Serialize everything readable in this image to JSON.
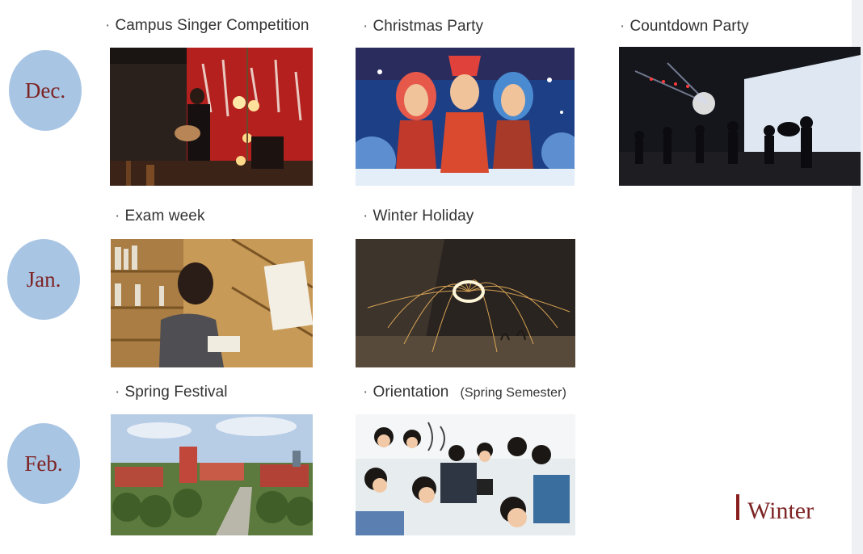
{
  "months": [
    {
      "label": "Dec."
    },
    {
      "label": "Jan."
    },
    {
      "label": "Feb."
    }
  ],
  "events": {
    "campus_singer": "Campus Singer Competition",
    "christmas_party": "Christmas Party",
    "countdown_party": "Countdown Party",
    "exam_week": "Exam week",
    "winter_holiday": "Winter Holiday",
    "spring_festival": "Spring Festival",
    "orientation": "Orientation",
    "orientation_note": "(Spring Semester)"
  },
  "bullet": "·",
  "season": "Winter",
  "colors": {
    "month_circle": "#a9c5e4",
    "month_text": "#7d2424",
    "season_accent": "#8b1f1f"
  }
}
